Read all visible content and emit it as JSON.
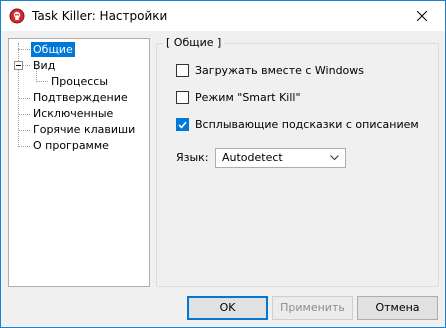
{
  "window": {
    "title": "Task Killer: Настройки"
  },
  "tree": {
    "items": [
      {
        "label": "Общие",
        "selected": true
      },
      {
        "label": "Вид"
      },
      {
        "label": "Процессы"
      },
      {
        "label": "Подтверждение"
      },
      {
        "label": "Исключенные"
      },
      {
        "label": "Горячие клавиши"
      },
      {
        "label": "О программе"
      }
    ]
  },
  "general": {
    "group_title": "[ Общие ]",
    "options": [
      {
        "label": "Загружать вместе с Windows",
        "checked": false
      },
      {
        "label": "Режим \"Smart Kill\"",
        "checked": false
      },
      {
        "label": "Всплывающие подсказки с описанием",
        "checked": true
      }
    ],
    "language": {
      "label": "Язык:",
      "value": "Autodetect"
    }
  },
  "buttons": {
    "ok": "OK",
    "apply": "Применить",
    "cancel": "Отмена"
  },
  "colors": {
    "accent": "#0078d7",
    "app_icon": "#d8262d"
  }
}
